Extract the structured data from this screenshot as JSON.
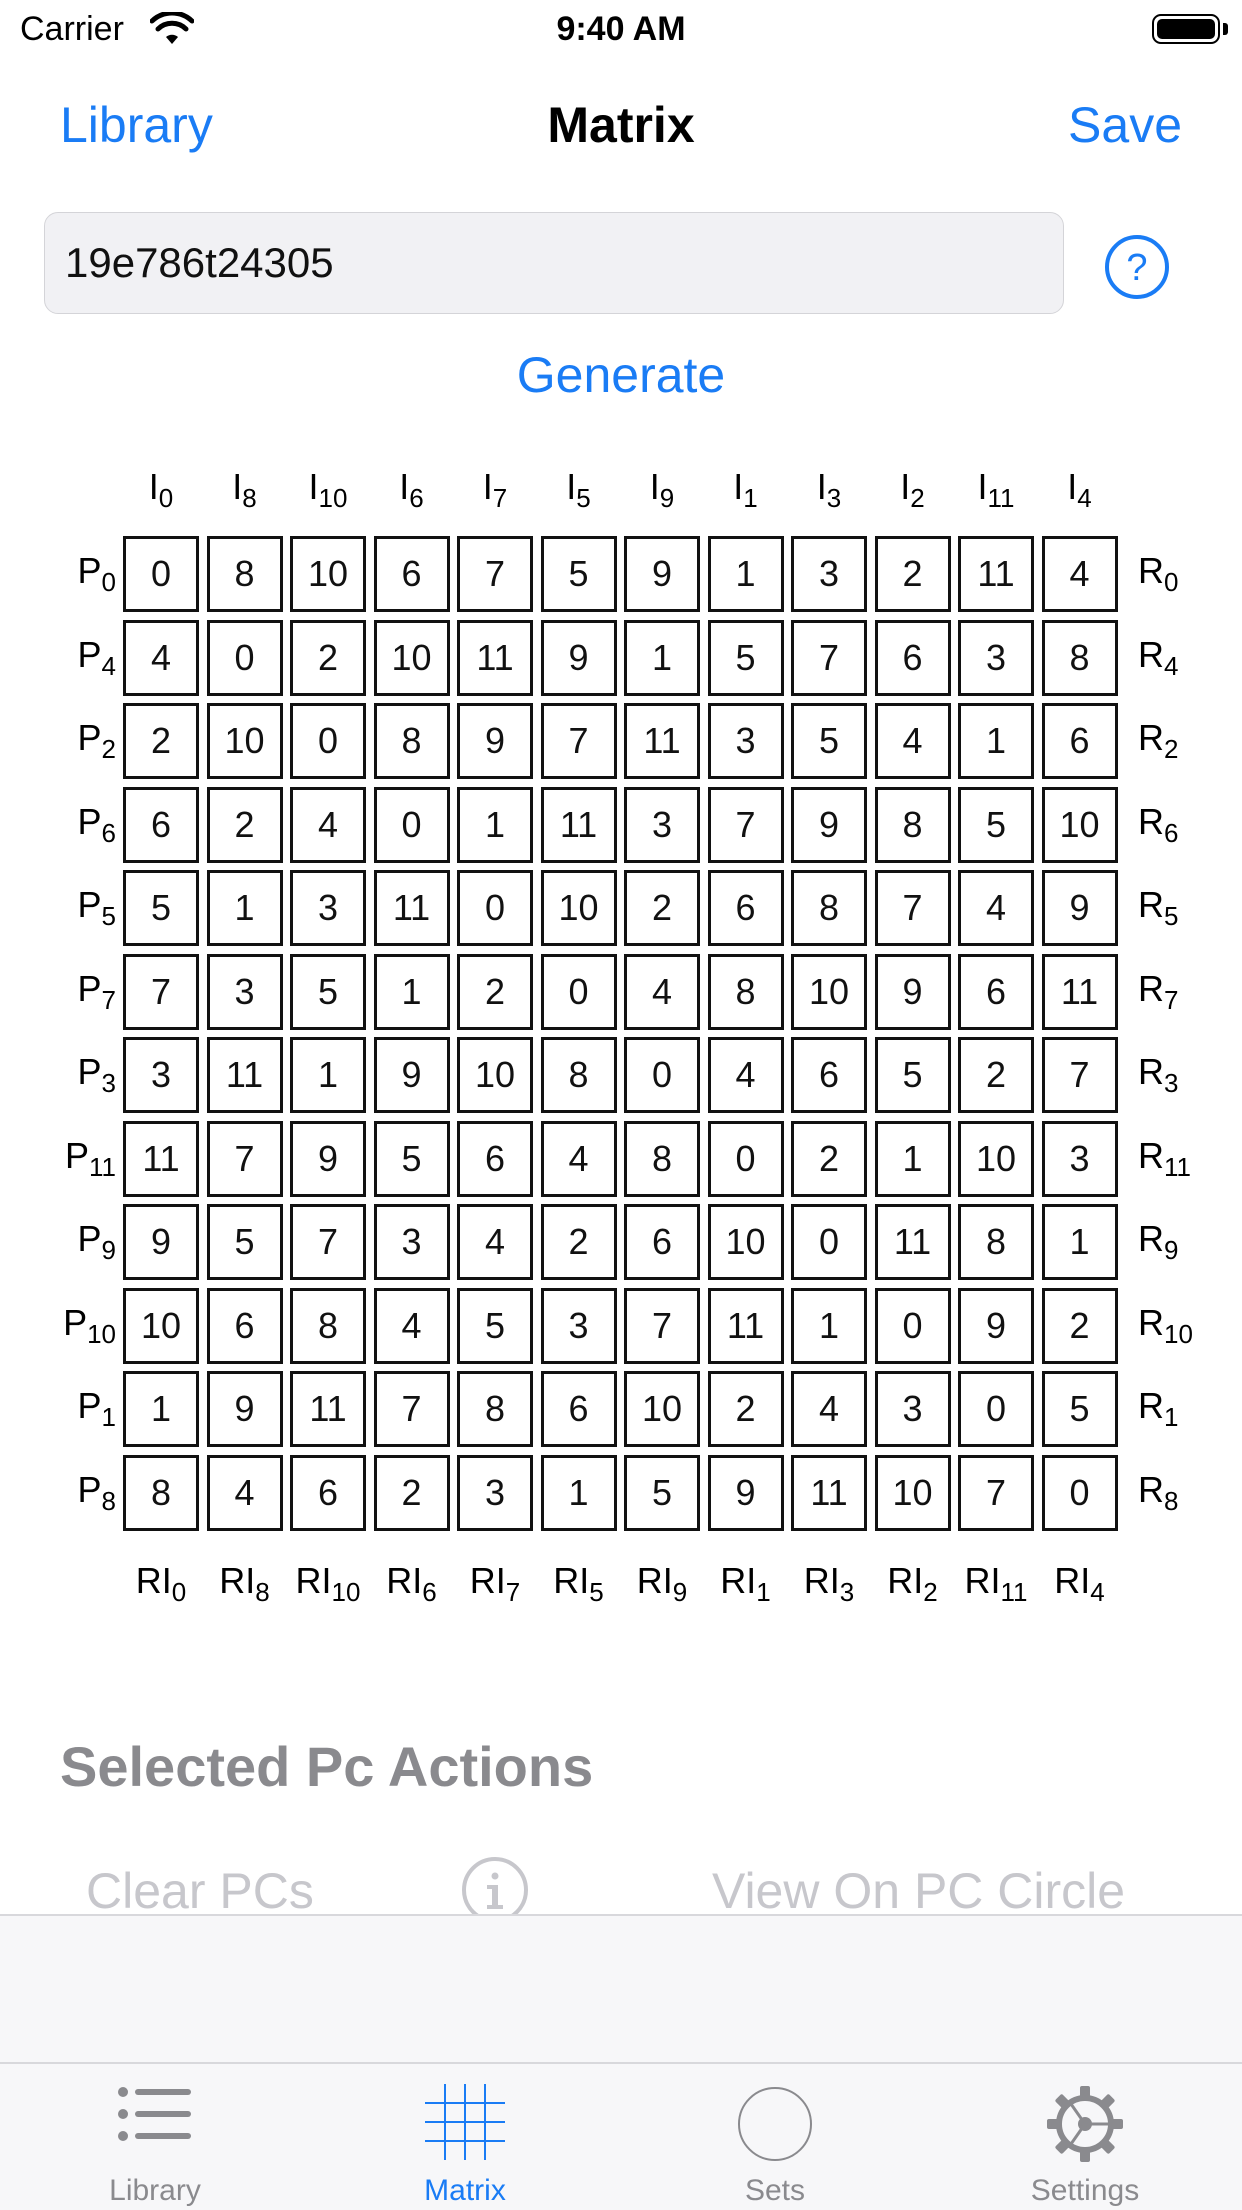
{
  "status_bar": {
    "carrier": "Carrier",
    "time": "9:40 AM"
  },
  "nav": {
    "left": "Library",
    "title": "Matrix",
    "right": "Save"
  },
  "input": {
    "value": "19e786t24305"
  },
  "generate_label": "Generate",
  "matrix": {
    "col_labels": [
      {
        "b": "I",
        "s": "0"
      },
      {
        "b": "I",
        "s": "8"
      },
      {
        "b": "I",
        "s": "10"
      },
      {
        "b": "I",
        "s": "6"
      },
      {
        "b": "I",
        "s": "7"
      },
      {
        "b": "I",
        "s": "5"
      },
      {
        "b": "I",
        "s": "9"
      },
      {
        "b": "I",
        "s": "1"
      },
      {
        "b": "I",
        "s": "3"
      },
      {
        "b": "I",
        "s": "2"
      },
      {
        "b": "I",
        "s": "11"
      },
      {
        "b": "I",
        "s": "4"
      }
    ],
    "row_labels": [
      {
        "b": "P",
        "s": "0"
      },
      {
        "b": "P",
        "s": "4"
      },
      {
        "b": "P",
        "s": "2"
      },
      {
        "b": "P",
        "s": "6"
      },
      {
        "b": "P",
        "s": "5"
      },
      {
        "b": "P",
        "s": "7"
      },
      {
        "b": "P",
        "s": "3"
      },
      {
        "b": "P",
        "s": "11"
      },
      {
        "b": "P",
        "s": "9"
      },
      {
        "b": "P",
        "s": "10"
      },
      {
        "b": "P",
        "s": "1"
      },
      {
        "b": "P",
        "s": "8"
      }
    ],
    "right_labels": [
      {
        "b": "R",
        "s": "0"
      },
      {
        "b": "R",
        "s": "4"
      },
      {
        "b": "R",
        "s": "2"
      },
      {
        "b": "R",
        "s": "6"
      },
      {
        "b": "R",
        "s": "5"
      },
      {
        "b": "R",
        "s": "7"
      },
      {
        "b": "R",
        "s": "3"
      },
      {
        "b": "R",
        "s": "11"
      },
      {
        "b": "R",
        "s": "9"
      },
      {
        "b": "R",
        "s": "10"
      },
      {
        "b": "R",
        "s": "1"
      },
      {
        "b": "R",
        "s": "8"
      }
    ],
    "bottom_labels": [
      {
        "b": "RI",
        "s": "0"
      },
      {
        "b": "RI",
        "s": "8"
      },
      {
        "b": "RI",
        "s": "10"
      },
      {
        "b": "RI",
        "s": "6"
      },
      {
        "b": "RI",
        "s": "7"
      },
      {
        "b": "RI",
        "s": "5"
      },
      {
        "b": "RI",
        "s": "9"
      },
      {
        "b": "RI",
        "s": "1"
      },
      {
        "b": "RI",
        "s": "3"
      },
      {
        "b": "RI",
        "s": "2"
      },
      {
        "b": "RI",
        "s": "11"
      },
      {
        "b": "RI",
        "s": "4"
      }
    ],
    "rows": [
      [
        0,
        8,
        10,
        6,
        7,
        5,
        9,
        1,
        3,
        2,
        11,
        4
      ],
      [
        4,
        0,
        2,
        10,
        11,
        9,
        1,
        5,
        7,
        6,
        3,
        8
      ],
      [
        2,
        10,
        0,
        8,
        9,
        7,
        11,
        3,
        5,
        4,
        1,
        6
      ],
      [
        6,
        2,
        4,
        0,
        1,
        11,
        3,
        7,
        9,
        8,
        5,
        10
      ],
      [
        5,
        1,
        3,
        11,
        0,
        10,
        2,
        6,
        8,
        7,
        4,
        9
      ],
      [
        7,
        3,
        5,
        1,
        2,
        0,
        4,
        8,
        10,
        9,
        6,
        11
      ],
      [
        3,
        11,
        1,
        9,
        10,
        8,
        0,
        4,
        6,
        5,
        2,
        7
      ],
      [
        11,
        7,
        9,
        5,
        6,
        4,
        8,
        0,
        2,
        1,
        10,
        3
      ],
      [
        9,
        5,
        7,
        3,
        4,
        2,
        6,
        10,
        0,
        11,
        8,
        1
      ],
      [
        10,
        6,
        8,
        4,
        5,
        3,
        7,
        11,
        1,
        0,
        9,
        2
      ],
      [
        1,
        9,
        11,
        7,
        8,
        6,
        10,
        2,
        4,
        3,
        0,
        5
      ],
      [
        8,
        4,
        6,
        2,
        3,
        1,
        5,
        9,
        11,
        10,
        7,
        0
      ]
    ]
  },
  "actions": {
    "title": "Selected Pc Actions",
    "clear": "Clear PCs",
    "view": "View On PC Circle"
  },
  "tabs": [
    {
      "label": "Library",
      "icon": "list-icon"
    },
    {
      "label": "Matrix",
      "icon": "grid-icon",
      "active": true
    },
    {
      "label": "Sets",
      "icon": "circle-icon"
    },
    {
      "label": "Settings",
      "icon": "gear-icon"
    }
  ],
  "colors": {
    "accent": "#1a7cf5",
    "inactive": "#8a8a8e",
    "disabled": "#c7c7cc"
  }
}
